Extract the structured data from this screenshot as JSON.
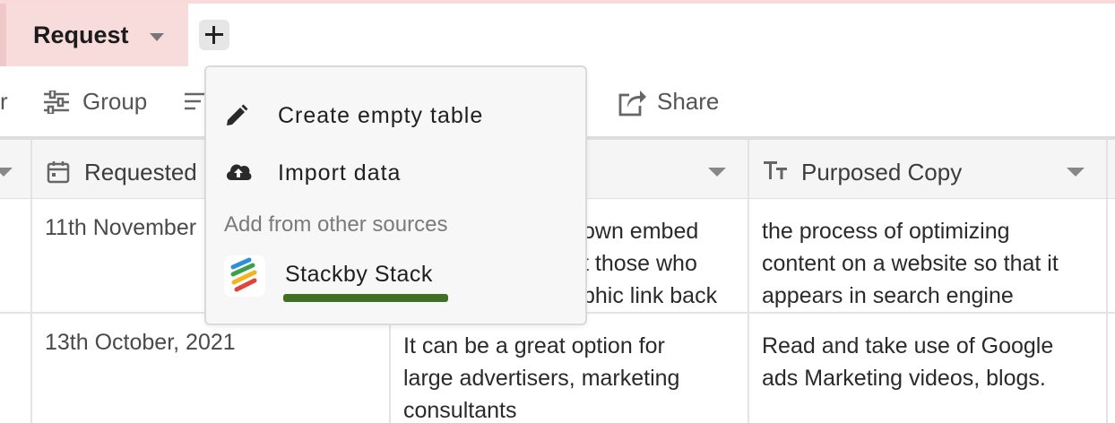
{
  "tabbar": {
    "active_tab_label": "Request",
    "add_table_icon": "plus-icon"
  },
  "toolbar": {
    "clip_left_text": "r",
    "group_label": "Group",
    "group_icon": "sliders-icon",
    "filter_icon": "filter-lines-icon",
    "clip_mid_text": "l",
    "share_label": "Share",
    "share_icon": "share-icon"
  },
  "grid": {
    "columns": [
      {
        "label": "",
        "icon": ""
      },
      {
        "label": "Requested",
        "icon": "calendar-icon"
      },
      {
        "label": "",
        "icon": ""
      },
      {
        "label": "Purposed Copy",
        "icon": "text-type-icon"
      }
    ],
    "rows": [
      {
        "requested": "11th November",
        "middle_lines": [
          "own embed",
          "t those who",
          "phic link back"
        ],
        "purposed_lines": [
          "the process of optimizing",
          "content on a website so that it",
          "appears in search engine"
        ]
      },
      {
        "requested": "13th October, 2021",
        "middle_lines": [
          "It can be a great option for",
          "large advertisers, marketing",
          "consultants"
        ],
        "purposed_lines": [
          "Read and take use of Google",
          "ads Marketing videos, blogs."
        ]
      }
    ]
  },
  "menu": {
    "items": [
      {
        "label": "Create empty table",
        "icon": "pencil-icon"
      },
      {
        "label": "Import data",
        "icon": "cloud-upload-icon"
      }
    ],
    "section_label": "Add from other sources",
    "stack_label": "Stackby Stack",
    "stack_icon": "stackby-logo-icon",
    "highlight_color": "#417024"
  },
  "colors": {
    "tab_bg": "#f8dcdc",
    "accent_underline": "#417024"
  }
}
